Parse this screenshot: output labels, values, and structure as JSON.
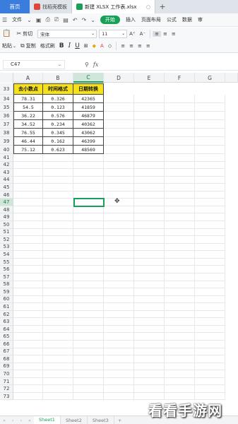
{
  "tabs": {
    "home": "首页",
    "template_tab": "找稻壳模板",
    "file_tab": "新建 XLSX 工作表.xlsx",
    "add_tab": "+"
  },
  "menu": {
    "file": "文件",
    "start": "开始",
    "insert": "插入",
    "page_layout": "页面布局",
    "formula": "公式",
    "data": "数据",
    "more": "审"
  },
  "toolbar": {
    "cut": "剪切",
    "paste": "粘贴",
    "copy": "复制",
    "format_painter": "格式刷",
    "font_name": "宋体",
    "font_size": "11",
    "grow_font": "A⁺",
    "shrink_font": "A⁻",
    "bold": "B",
    "italic": "I",
    "underline": "U"
  },
  "formula_bar": {
    "cell_ref": "C47",
    "fx": "fx",
    "formula": ""
  },
  "columns": [
    "A",
    "B",
    "C",
    "D",
    "E",
    "F",
    "G"
  ],
  "selected_column": "C",
  "table": {
    "headers": [
      "去小数点",
      "时间格式",
      "日期转换"
    ],
    "header_row": "33",
    "rows": [
      {
        "row": "34",
        "a": "78.31",
        "b": "0.326",
        "c": "42365"
      },
      {
        "row": "35",
        "a": "54.5",
        "b": "0.123",
        "c": "41859"
      },
      {
        "row": "36",
        "a": "36.22",
        "b": "0.576",
        "c": "46879"
      },
      {
        "row": "37",
        "a": "34.52",
        "b": "0.234",
        "c": "40362"
      },
      {
        "row": "38",
        "a": "76.55",
        "b": "0.345",
        "c": "43062"
      },
      {
        "row": "39",
        "a": "46.44",
        "b": "0.162",
        "c": "46399"
      },
      {
        "row": "40",
        "a": "75.12",
        "b": "0.623",
        "c": "48569"
      }
    ]
  },
  "empty_rows": [
    "41",
    "42",
    "43",
    "44",
    "45",
    "46",
    "47",
    "48",
    "49",
    "50",
    "51",
    "52",
    "53",
    "54",
    "55",
    "56",
    "57",
    "58",
    "59",
    "60",
    "61",
    "62",
    "63",
    "64",
    "65",
    "66",
    "67",
    "68",
    "69",
    "70",
    "71",
    "72",
    "73"
  ],
  "selected_row": "47",
  "sheets": [
    "Sheet1",
    "Sheet2",
    "Sheet3"
  ],
  "active_sheet": "Sheet1",
  "add_sheet": "+",
  "watermark": "看看手游网",
  "colors": {
    "accent_green": "#18a058",
    "header_yellow": "#f7e21a",
    "home_blue": "#3b7ddd"
  }
}
